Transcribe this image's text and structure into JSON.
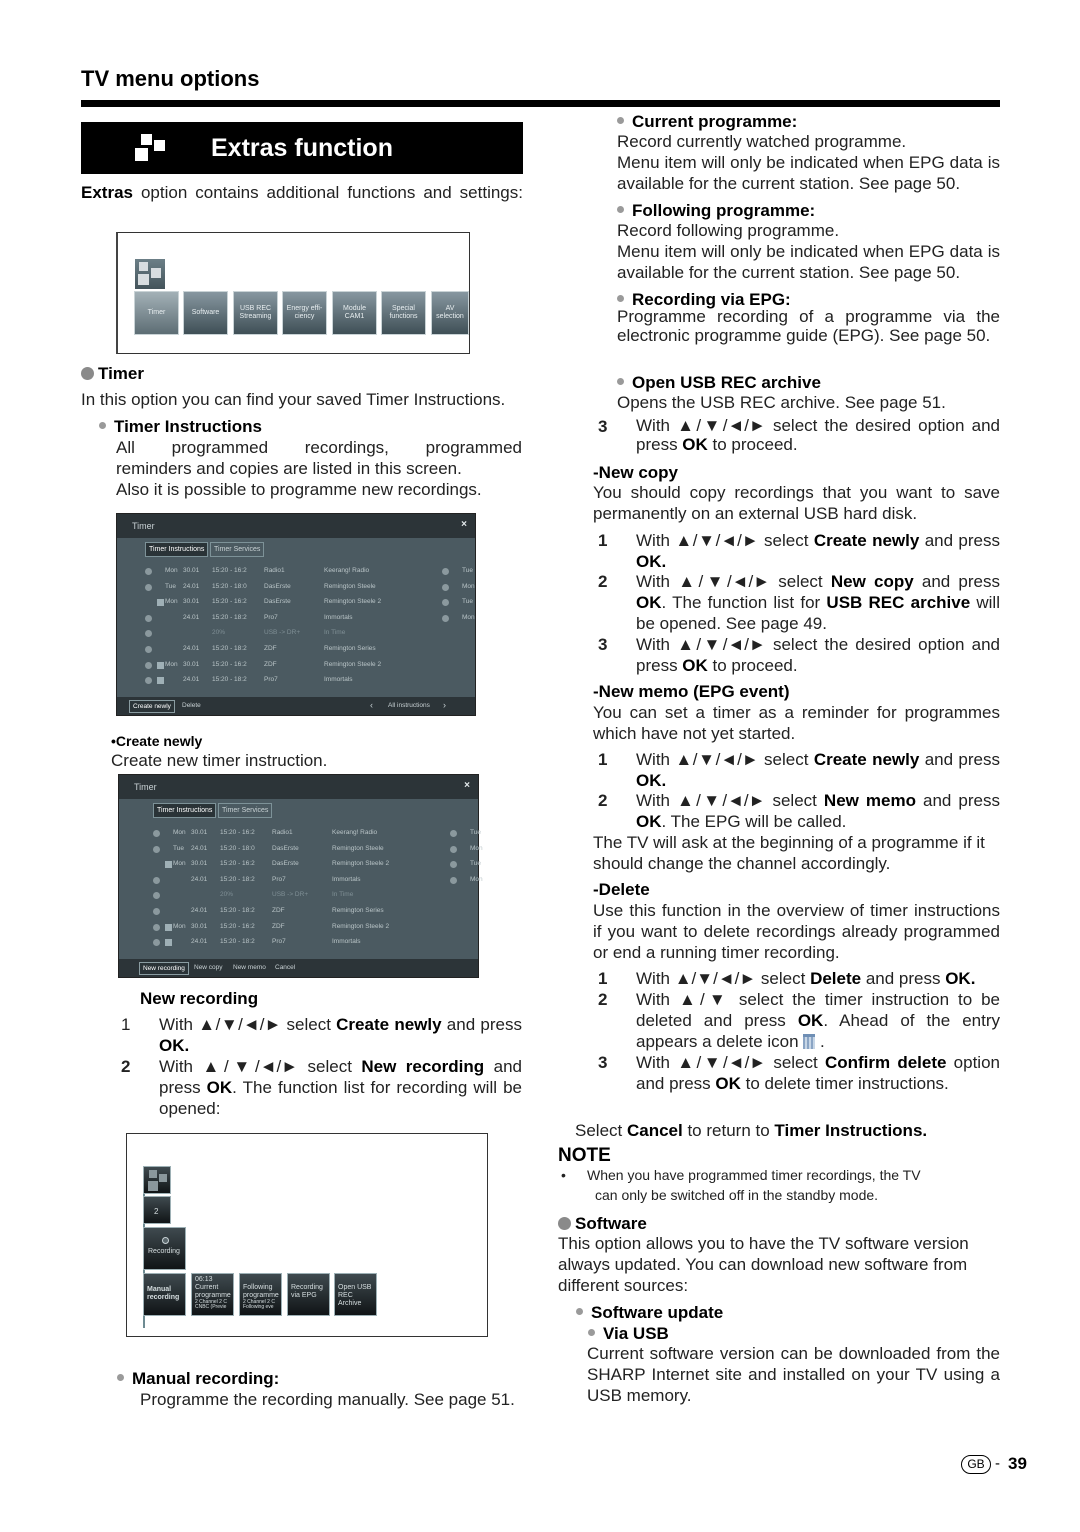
{
  "header": {
    "title": "TV menu options"
  },
  "banner": {
    "title": "Extras function",
    "icon": "extras-squares-icon"
  },
  "intro": {
    "bold": "Extras",
    "text": " option contains additional functions and settings:"
  },
  "extras_menu": {
    "tiles": [
      "Timer",
      "Software",
      "USB REC Streaming",
      "Energy effi-ciency",
      "Module CAM1",
      "Special functions",
      "AV selection"
    ]
  },
  "timer_section": {
    "heading": "Timer",
    "desc": "In this option you can find your saved Timer Instructions.",
    "instructions_heading": "Timer Instructions",
    "instructions_text_1": "All programmed recordings, programmed",
    "instructions_text_2": "reminders and copies are listed in this screen.",
    "instructions_text_3": "Also it is possible to programme new recordings."
  },
  "timer_screen_1": {
    "title": "Timer",
    "close": "×",
    "tabs": [
      "Timer Instructions",
      "Timer Services"
    ],
    "rows": [
      {
        "day": "Mon",
        "date": "30.01",
        "time": "15:20 - 16:2",
        "channel": "Radio1",
        "title": "Keerang! Radio",
        "right": "Tue"
      },
      {
        "day": "Tue",
        "date": "24.01",
        "time": "15:20 - 18:0",
        "channel": "DasErste",
        "title": "Remington Steele",
        "right": "Mon"
      },
      {
        "day": "Mon",
        "date": "30.01",
        "time": "15:20 - 16:2",
        "channel": "DasErste",
        "title": "Remington Steele 2",
        "right": "Tue"
      },
      {
        "day": "",
        "date": "24.01",
        "time": "15:20 - 18:2",
        "channel": "Pro7",
        "title": "Immortals",
        "right": "Mon"
      },
      {
        "day": "",
        "date": "",
        "time": "20%",
        "channel": "USB -> DR+",
        "title": "In Time",
        "right": ""
      },
      {
        "day": "",
        "date": "24.01",
        "time": "15:20 - 18:2",
        "channel": "ZDF",
        "title": "Remington Series",
        "right": ""
      },
      {
        "day": "Mon",
        "date": "30.01",
        "time": "15:20 - 16:2",
        "channel": "ZDF",
        "title": "Remington Steele 2",
        "right": ""
      },
      {
        "day": "",
        "date": "24.01",
        "time": "15:20 - 18:2",
        "channel": "Pro7",
        "title": "Immortals",
        "right": ""
      }
    ],
    "footer_buttons": [
      "Create newly",
      "Delete"
    ],
    "nav_label": "All instructions"
  },
  "create_newly": {
    "heading": "•Create newly",
    "text": "Create new timer instruction."
  },
  "timer_screen_2": {
    "title": "Timer",
    "close": "×",
    "tabs": [
      "Timer Instructions",
      "Timer Services"
    ],
    "footer_buttons": [
      "New recording",
      "New copy",
      "New memo",
      "Cancel"
    ]
  },
  "new_recording": {
    "heading": "New recording",
    "steps": [
      {
        "num": "1",
        "pre": "With ▲/▼/◄/► select ",
        "bold": "Create newly",
        "post": " and press ",
        "bold2": "OK."
      },
      {
        "num": "2",
        "pre": "With ▲/▼/◄/► select ",
        "bold": "New recording",
        "post": " and press ",
        "bold2": "OK",
        "post2": ". The function list for recording will be opened:"
      }
    ]
  },
  "recording_screen": {
    "badge": "2",
    "recording_label": "Recording",
    "tiles": [
      {
        "label": "Manual recording"
      },
      {
        "time": "06:13",
        "label": "Current programme",
        "sub": "2 Channel 2 C CNBC (Previe"
      },
      {
        "label": "Following programme",
        "sub": "2 Channel 2 C Following eve"
      },
      {
        "label": "Recording via EPG"
      },
      {
        "label": "Open USB REC Archive"
      }
    ]
  },
  "manual_recording": {
    "heading": "Manual recording:",
    "text": "Programme the recording manually. See page 51."
  },
  "right_col": {
    "current": {
      "heading": "Current programme:",
      "l1": "Record currently watched programme.",
      "l2": "Menu item will only be indicated when EPG data is available for the current station. See page 50."
    },
    "following": {
      "heading": "Following programme:",
      "l1": "Record following programme.",
      "l2": "Menu item will only be indicated when EPG data is available for the current station. See page 50."
    },
    "via_epg": {
      "heading": "Recording via EPG:",
      "l1": "Programme recording of a programme via the electronic programme guide (EPG). See page 50."
    },
    "open_usb": {
      "heading": "Open USB REC archive",
      "l1": "Opens the USB REC archive. See page 51."
    },
    "step3": {
      "num": "3",
      "pre": "With ▲/▼/◄/► select the desired option and press ",
      "bold": "OK",
      "post": " to proceed."
    },
    "new_copy": {
      "heading": "-New copy",
      "text": "You should copy recordings that you want to save permanently on an external USB hard disk.",
      "s1": {
        "num": "1",
        "pre": "With ▲/▼/◄/► select ",
        "bold": "Create newly",
        "post": " and press ",
        "bold2": "OK."
      },
      "s2": {
        "num": "2",
        "pre": "With ▲/▼/◄/► select ",
        "bold": "New copy",
        "post": " and press ",
        "bold2": "OK",
        "post2": ". The function list for ",
        "bold3": "USB REC archive",
        "post3": " will be opened. See page 49."
      },
      "s3": {
        "num": "3",
        "pre": "With ▲/▼/◄/► select the desired option and press ",
        "bold": "OK",
        "post": " to proceed."
      }
    },
    "new_memo": {
      "heading": "-New memo (EPG event)",
      "text": "You can set a timer as a reminder for programmes which have not yet  started.",
      "s1": {
        "num": "1",
        "pre": "With ▲/▼/◄/► select ",
        "bold": "Create newly",
        "post": " and press ",
        "bold2": "OK."
      },
      "s2": {
        "num": "2",
        "pre": "With ▲/▼/◄/► select ",
        "bold": "New memo",
        "post": " and press ",
        "bold2": "OK",
        "post2": ". The EPG will be called."
      },
      "after": "The TV will ask at the beginning of a programme if it should change the channel accordingly."
    },
    "delete": {
      "heading": "-Delete",
      "text": "Use this function in the overview of timer instructions if you want to delete recordings already programmed or end a running timer recording.",
      "s1": {
        "num": "1",
        "pre": "With ▲/▼/◄/► select ",
        "bold": "Delete",
        "post": " and press ",
        "bold2": "OK."
      },
      "s2": {
        "num": "2",
        "pre": "With ▲/▼ select the timer instruction to be deleted and press ",
        "bold": "OK",
        "post": ". Ahead of the entry appears a delete icon ",
        "post2": " ."
      },
      "s3": {
        "num": "3",
        "pre": "With ▲/▼/◄/► select ",
        "bold": "Confirm delete",
        "post": " option and press ",
        "bold2": "OK",
        "post2": " to delete timer instructions."
      },
      "cancel_pre": "Select ",
      "cancel_bold": "Cancel",
      "cancel_mid": " to return to ",
      "cancel_bold2": "Timer Instructions."
    },
    "note": {
      "heading": "NOTE",
      "bullet": "•",
      "text1": "When you have programmed timer recordings, the TV",
      "text2": "can only be switched off in the standby mode."
    },
    "software": {
      "heading": "Software",
      "text": "This option allows you to have the TV software version always updated. You can download new software from different sources:",
      "update_heading": "Software update",
      "usb_heading": "Via USB",
      "usb_text": "Current software version can be downloaded from the SHARP Internet site and installed on your TV using a USB memory."
    }
  },
  "footer": {
    "region": "GB",
    "separator": "-",
    "page": "39"
  }
}
